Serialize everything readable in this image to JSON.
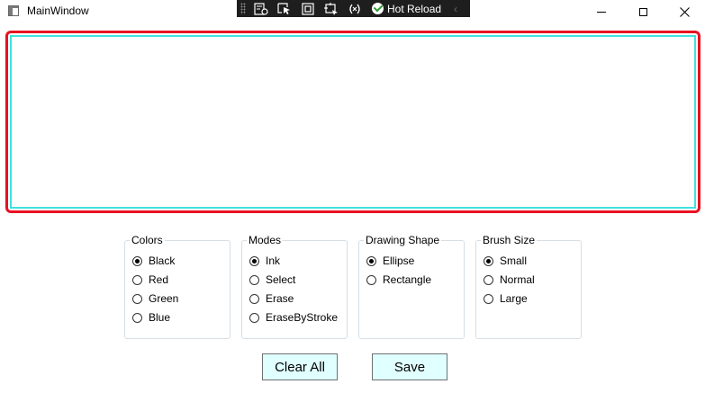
{
  "window": {
    "title": "MainWindow"
  },
  "devbar": {
    "hot_reload_label": "Hot Reload",
    "collapse_glyph": "‹"
  },
  "groups": {
    "colors": {
      "title": "Colors",
      "options": [
        "Black",
        "Red",
        "Green",
        "Blue"
      ],
      "selected": "Black"
    },
    "modes": {
      "title": "Modes",
      "options": [
        "Ink",
        "Select",
        "Erase",
        "EraseByStroke"
      ],
      "selected": "Ink"
    },
    "shape": {
      "title": "Drawing Shape",
      "options": [
        "Ellipse",
        "Rectangle"
      ],
      "selected": "Ellipse"
    },
    "brush": {
      "title": "Brush Size",
      "options": [
        "Small",
        "Normal",
        "Large"
      ],
      "selected": "Small"
    }
  },
  "buttons": {
    "clear_label": "Clear All",
    "save_label": "Save"
  },
  "colors": {
    "canvas_border": "#e81123",
    "canvas_inner_border": "#40e0e0",
    "button_bg": "#e0ffff",
    "devbar_bg": "#1e1e1e"
  },
  "icons": [
    "app-icon",
    "minimize-icon",
    "maximize-icon",
    "close-icon",
    "live-visual-tree-icon",
    "select-element-icon",
    "display-layout-adorners-icon",
    "track-focused-element-icon",
    "binding-failures-icon",
    "hot-reload-check-icon"
  ]
}
